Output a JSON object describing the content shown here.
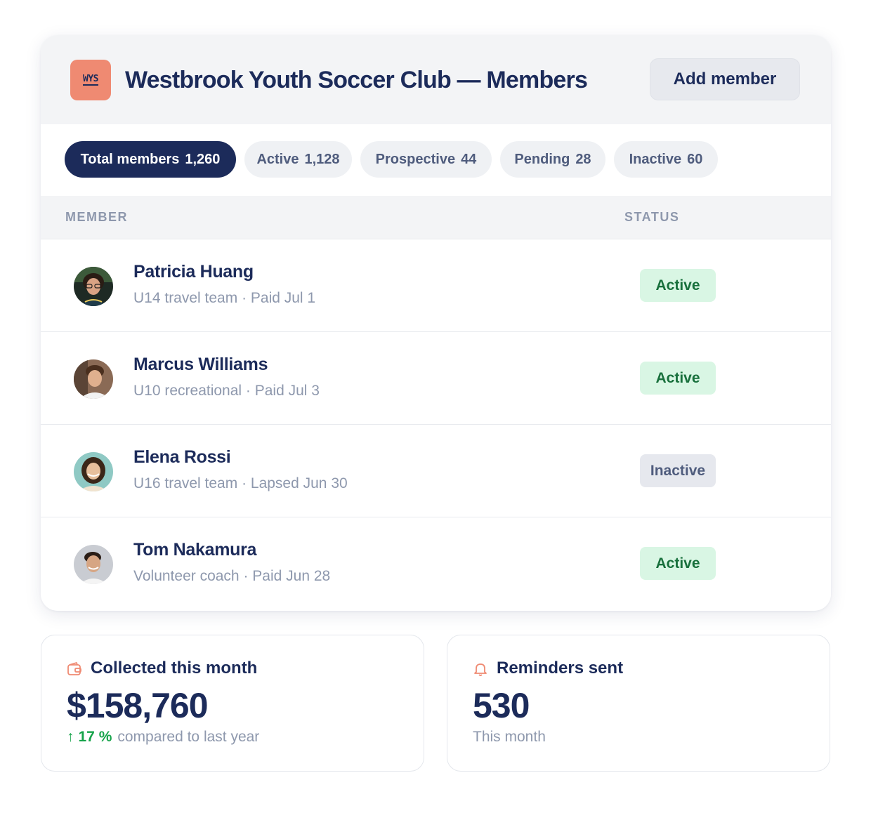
{
  "header": {
    "logo_text": "WYS",
    "title": "Westbrook Youth Soccer Club — Members",
    "add_button": "Add member"
  },
  "filters": [
    {
      "label": "Total members",
      "count": "1,260",
      "selected": true
    },
    {
      "label": "Active",
      "count": "1,128",
      "selected": false
    },
    {
      "label": "Prospective",
      "count": "44",
      "selected": false
    },
    {
      "label": "Pending",
      "count": "28",
      "selected": false
    },
    {
      "label": "Inactive",
      "count": "60",
      "selected": false
    }
  ],
  "table": {
    "columns": {
      "member": "MEMBER",
      "status": "STATUS"
    },
    "rows": [
      {
        "name": "Patricia Huang",
        "detail": "U14 travel team · Paid Jul 1",
        "status": "Active"
      },
      {
        "name": "Marcus Williams",
        "detail": "U10 recreational · Paid Jul 3",
        "status": "Active"
      },
      {
        "name": "Elena Rossi",
        "detail": "U16 travel team · Lapsed Jun 30",
        "status": "Inactive"
      },
      {
        "name": "Tom Nakamura",
        "detail": "Volunteer coach · Paid Jun 28",
        "status": "Active"
      }
    ]
  },
  "stats": {
    "collected": {
      "icon": "wallet-icon",
      "label": "Collected this month",
      "value": "$158,760",
      "trend_arrow": "↑",
      "trend_value": "17 %",
      "trend_text": "compared to last year"
    },
    "reminders": {
      "icon": "bell-icon",
      "label": "Reminders sent",
      "value": "530",
      "note": "This month"
    }
  },
  "colors": {
    "navy": "#1c2b5a",
    "accent": "#ef8a72",
    "active_bg": "#d9f6e4",
    "active_text": "#18703c",
    "inactive_bg": "#e6e8ee",
    "trend_green": "#16a34a"
  }
}
